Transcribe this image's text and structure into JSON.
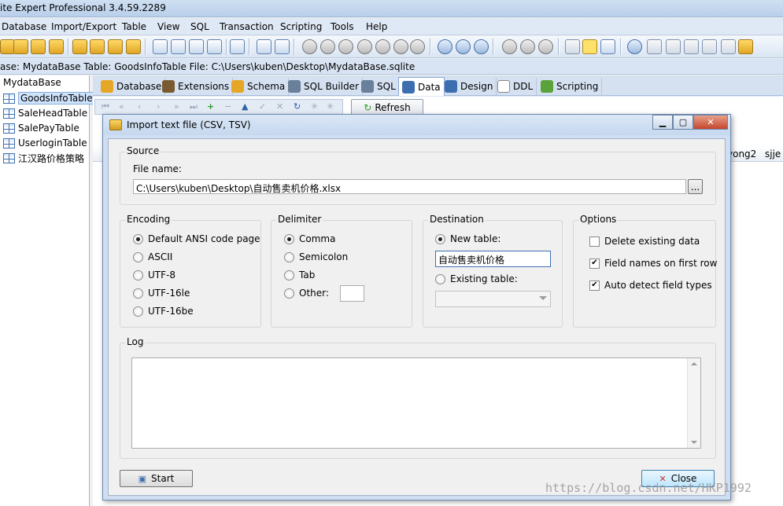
{
  "window": {
    "title": "ite Expert Professional 3.4.59.2289"
  },
  "menu": [
    "Database",
    "Import/Export",
    "Table",
    "View",
    "SQL",
    "Transaction",
    "Scripting",
    "Tools",
    "Help"
  ],
  "pathbar": {
    "text": "ase: MydataBase   Table: GoodsInfoTable   File: C:\\Users\\kuben\\Desktop\\MydataBase.sqlite"
  },
  "tree": {
    "root": "MydataBase",
    "tables": [
      "GoodsInfoTable",
      "SaleHeadTable",
      "SalePayTable",
      "UserloginTable",
      "江汉路价格策略"
    ],
    "selected": "GoodsInfoTable"
  },
  "tabs": [
    {
      "label": "Database",
      "icon": "database-icon",
      "color": "#e6a726"
    },
    {
      "label": "Extensions",
      "icon": "extensions-icon",
      "color": "#7a5a30"
    },
    {
      "label": "Schema",
      "icon": "schema-icon",
      "color": "#e6a726"
    },
    {
      "label": "SQL Builder",
      "icon": "sql-builder-icon",
      "color": "#6a7f99"
    },
    {
      "label": "SQL",
      "icon": "sql-icon",
      "color": "#6a7f99"
    },
    {
      "label": "Data",
      "icon": "data-icon",
      "color": "#3d6fb0"
    },
    {
      "label": "Design",
      "icon": "design-icon",
      "color": "#3d6fb0"
    },
    {
      "label": "DDL",
      "icon": "ddl-icon",
      "color": "#888888"
    },
    {
      "label": "Scripting",
      "icon": "scripting-icon",
      "color": "#5aa33a"
    }
  ],
  "active_tab": "Data",
  "grid": {
    "refresh_label": "Refresh",
    "columns_visible": [
      "yong2",
      "sjje"
    ]
  },
  "dialog": {
    "title": "Import text file (CSV, TSV)",
    "source": {
      "title": "Source",
      "file_name_label": "File name:",
      "file_name_value": "C:\\Users\\kuben\\Desktop\\自动售卖机价格.xlsx",
      "browse_label": "..."
    },
    "encoding": {
      "title": "Encoding",
      "options": [
        "Default ANSI code page",
        "ASCII",
        "UTF-8",
        "UTF-16le",
        "UTF-16be"
      ],
      "selected": "Default ANSI code page"
    },
    "delimiter": {
      "title": "Delimiter",
      "options": [
        "Comma",
        "Semicolon",
        "Tab",
        "Other:"
      ],
      "selected": "Comma",
      "other_value": ""
    },
    "destination": {
      "title": "Destination",
      "new_table_label": "New table:",
      "new_table_value": "自动售卖机价格",
      "existing_table_label": "Existing table:",
      "existing_table_value": "",
      "selected": "New table:"
    },
    "options": {
      "title": "Options",
      "items": [
        {
          "label": "Delete existing data",
          "checked": false
        },
        {
          "label": "Field names on first row",
          "checked": true
        },
        {
          "label": "Auto detect field types",
          "checked": true
        }
      ]
    },
    "log": {
      "title": "Log",
      "content": ""
    },
    "start_label": "Start",
    "close_label": "Close"
  },
  "watermark": "https://blog.csdn.net/HKP1992"
}
